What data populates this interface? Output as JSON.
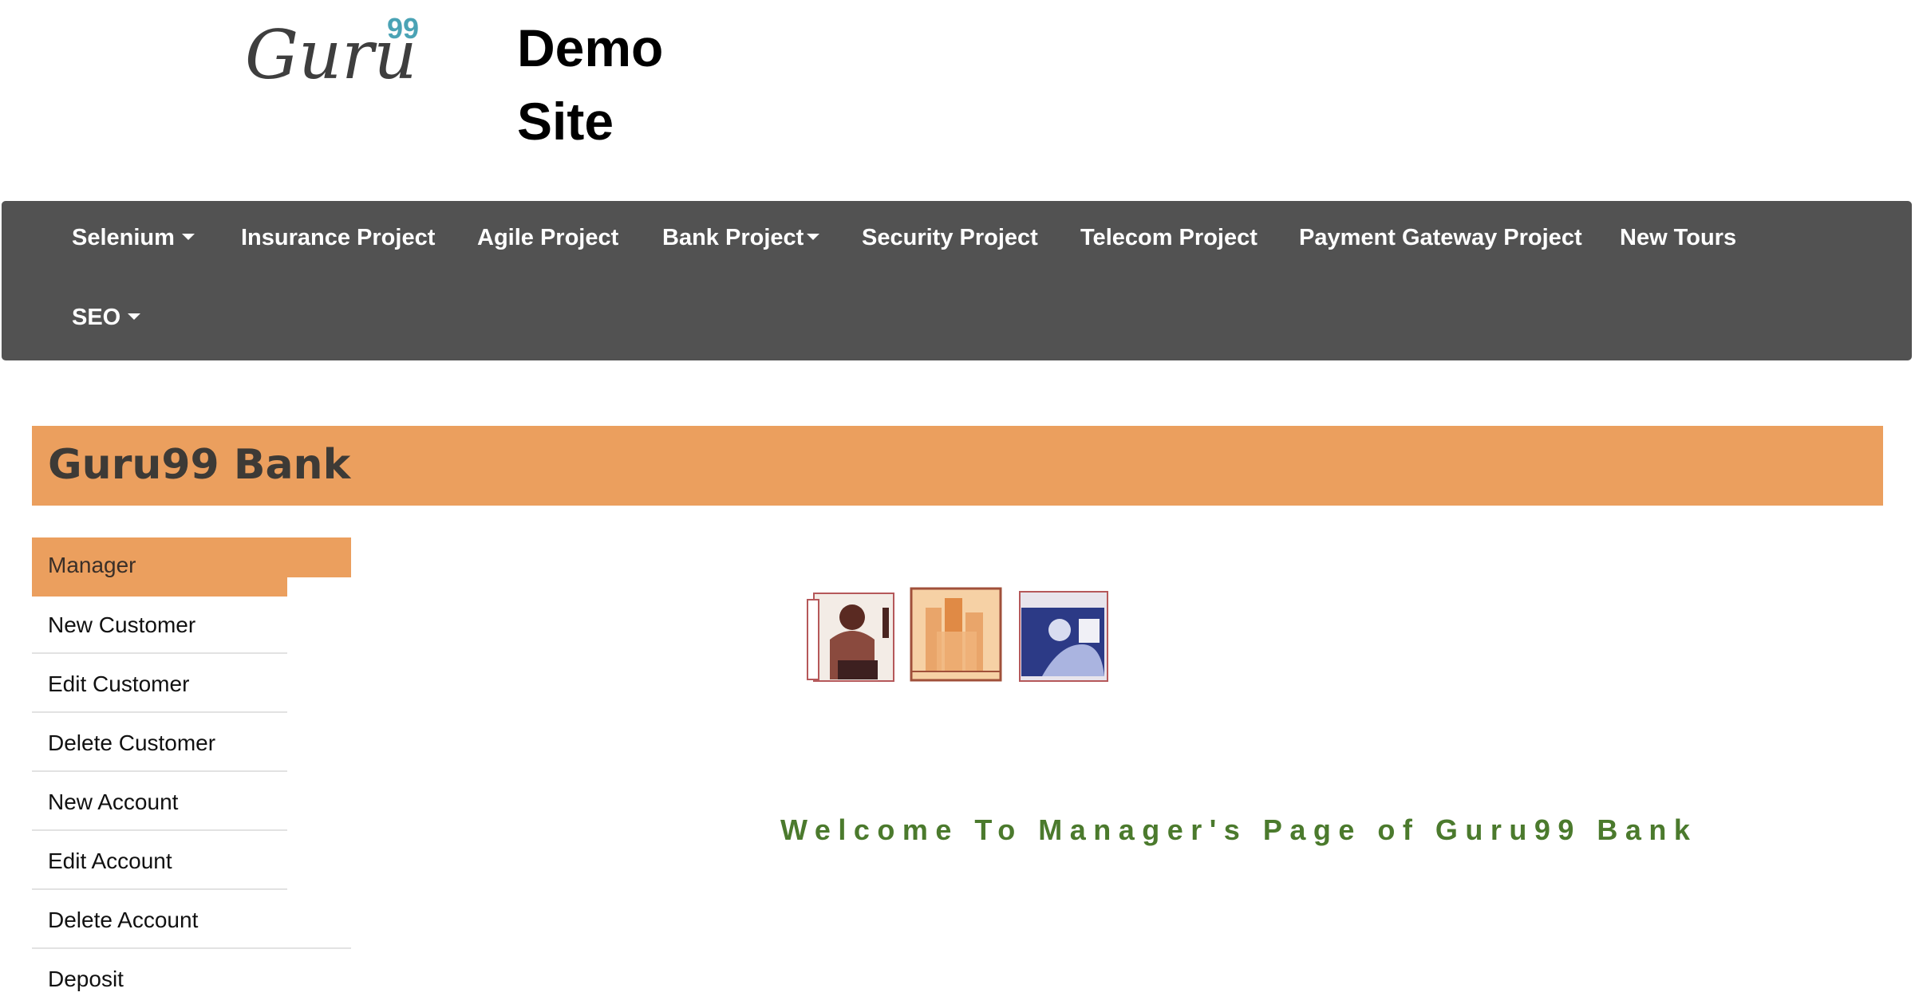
{
  "header": {
    "logo_text": "Guru",
    "logo_superscript": "99",
    "site_title_line1": "Demo",
    "site_title_line2": "Site"
  },
  "navbar": {
    "items": [
      {
        "label": "Selenium",
        "dropdown": true
      },
      {
        "label": "Insurance Project",
        "dropdown": false
      },
      {
        "label": "Agile Project",
        "dropdown": false
      },
      {
        "label": "Bank Project",
        "dropdown": true
      },
      {
        "label": "Security Project",
        "dropdown": false
      },
      {
        "label": "Telecom Project",
        "dropdown": false
      },
      {
        "label": "Payment Gateway Project",
        "dropdown": false
      },
      {
        "label": "New Tours",
        "dropdown": false
      },
      {
        "label": "SEO",
        "dropdown": true
      }
    ],
    "caret_icon": "caret-down-icon"
  },
  "bank": {
    "title": "Guru99 Bank"
  },
  "menu": {
    "header": "Manager",
    "items": [
      "New Customer",
      "Edit Customer",
      "Delete Customer",
      "New Account",
      "Edit Account",
      "Delete Account",
      "Deposit"
    ]
  },
  "main": {
    "banner_icon": "bank-banner-image",
    "welcome": "Welcome To Manager's Page of Guru99 Bank"
  },
  "colors": {
    "nav_bg": "#525252",
    "accent_orange": "#eb9f5e",
    "welcome_green": "#4b7a2d",
    "logo_gray": "#3e3e3e",
    "logo_teal": "#4aa3b5"
  }
}
